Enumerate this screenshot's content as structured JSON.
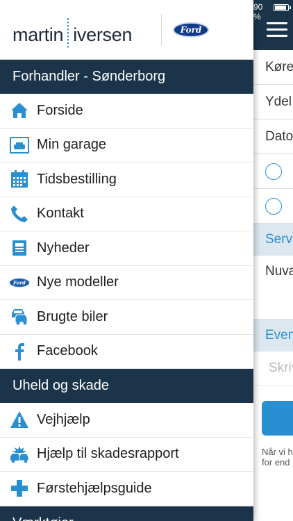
{
  "status_bar": {
    "battery_text": "90 %",
    "battery_level": 0.9
  },
  "brand": {
    "logo_left": "martin",
    "logo_right": "iversen",
    "ford_badge": "Ford"
  },
  "drawer": {
    "sections": [
      {
        "header": "Forhandler - Sønderborg",
        "items": [
          {
            "label": "Forside",
            "icon": "house-icon"
          },
          {
            "label": "Min garage",
            "icon": "garage-icon"
          },
          {
            "label": "Tidsbestilling",
            "icon": "calendar-icon"
          },
          {
            "label": "Kontakt",
            "icon": "phone-icon"
          },
          {
            "label": "Nyheder",
            "icon": "newspaper-icon"
          },
          {
            "label": "Nye modeller",
            "icon": "ford-logo-icon"
          },
          {
            "label": "Brugte biler",
            "icon": "used-cars-icon"
          },
          {
            "label": "Facebook",
            "icon": "facebook-icon"
          }
        ]
      },
      {
        "header": "Uheld og skade",
        "items": [
          {
            "label": "Vejhjælp",
            "icon": "warning-icon"
          },
          {
            "label": "Hjælp til skadesrapport",
            "icon": "crash-icon"
          },
          {
            "label": "Førstehjælpsguide",
            "icon": "first-aid-icon"
          }
        ]
      },
      {
        "header": "Værktøjer"
      }
    ]
  },
  "background_page": {
    "rows": [
      "Køre",
      "Ydel",
      "Dato"
    ],
    "section_service": "Serv",
    "row_current": "Nuva",
    "section_event": "Even",
    "input_placeholder": "Skriv",
    "note_line1": "Når vi h",
    "note_line2": "for end"
  },
  "colors": {
    "navy": "#1b3449",
    "accent_blue": "#2a8fd0",
    "icon_blue": "#2a8fd0"
  }
}
